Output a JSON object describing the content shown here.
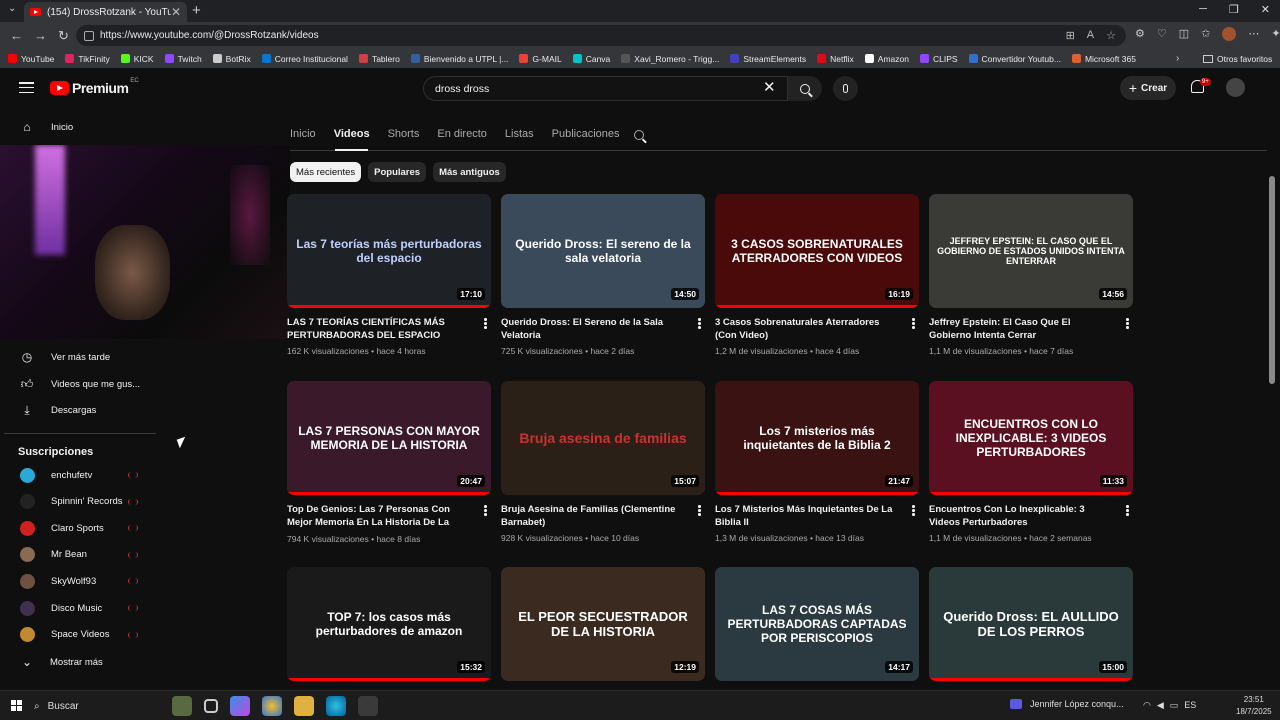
{
  "browser": {
    "tab_title": "(154) DrossRotzank - YouTube",
    "tab_close": "✕",
    "new_tab": "+",
    "url": "https://www.youtube.com/@DrossRotzank/videos",
    "bookmarks": [
      {
        "label": "YouTube",
        "color": "#ff0000"
      },
      {
        "label": "TikFinity",
        "color": "#e0245e"
      },
      {
        "label": "KICK",
        "color": "#53fc18"
      },
      {
        "label": "Twitch",
        "color": "#9146ff"
      },
      {
        "label": "BotRix",
        "color": "#cccccc"
      },
      {
        "label": "Correo Institucional",
        "color": "#0078d4"
      },
      {
        "label": "Tablero",
        "color": "#d04040"
      },
      {
        "label": "Bienvenido a UTPL |...",
        "color": "#3060a0"
      },
      {
        "label": "G-MAIL",
        "color": "#ea4335"
      },
      {
        "label": "Canva",
        "color": "#00c4cc"
      },
      {
        "label": "Xavi_Romero - Trigg...",
        "color": "#555555"
      },
      {
        "label": "StreamElements",
        "color": "#4040c0"
      },
      {
        "label": "Netflix",
        "color": "#e50914"
      },
      {
        "label": "Amazon",
        "color": "#ffffff"
      },
      {
        "label": "CLIPS",
        "color": "#9146ff"
      },
      {
        "label": "Convertidor Youtub...",
        "color": "#3070d0"
      },
      {
        "label": "Microsoft 365",
        "color": "#e06030"
      }
    ],
    "bookmarks_more": "›",
    "other_favorites": "Otros favoritos"
  },
  "header": {
    "logo_text": "Premium",
    "country": "EC",
    "search_value": "dross dross",
    "create_label": "Crear",
    "notif_count": "9+"
  },
  "sidebar": {
    "home": "Inicio",
    "watch_later": "Ver más tarde",
    "liked": "Videos que me gus...",
    "downloads": "Descargas",
    "subs_title": "Suscripciones",
    "subscriptions": [
      {
        "name": "enchufetv",
        "color": "#2aa8d8"
      },
      {
        "name": "Spinnin' Records",
        "color": "#222222"
      },
      {
        "name": "Claro Sports",
        "color": "#d02020"
      },
      {
        "name": "Mr Bean",
        "color": "#8a6a50"
      },
      {
        "name": "SkyWolf93",
        "color": "#705040"
      },
      {
        "name": "Disco Music",
        "color": "#403050"
      },
      {
        "name": "Space Videos",
        "color": "#c08a30"
      }
    ],
    "show_more": "Mostrar más"
  },
  "channel": {
    "tabs": [
      "Inicio",
      "Videos",
      "Shorts",
      "En directo",
      "Listas",
      "Publicaciones"
    ],
    "chips": [
      "Más recientes",
      "Populares",
      "Más antiguos"
    ]
  },
  "videos": [
    {
      "thumb_text": "Las 7 teorías más perturbadoras del espacio",
      "thumb_bg": "#1e2226",
      "thumb_color": "#c0d0ff",
      "duration": "17:10",
      "title": "LAS 7 TEORÍAS CIENTÍFICAS MÁS PERTURBADORAS DEL ESPACIO",
      "meta": "162 K visualizaciones • hace 4 horas",
      "progress": 1.0
    },
    {
      "thumb_text": "Querido Dross: El sereno de la sala velatoria",
      "thumb_bg": "#3a4a5a",
      "thumb_color": "#ffffff",
      "duration": "14:50",
      "title": "Querido Dross: El Sereno de la Sala Velatoria",
      "meta": "725 K visualizaciones • hace 2 días",
      "progress": 0
    },
    {
      "thumb_text": "3 CASOS SOBRENATURALES ATERRADORES CON VIDEOS",
      "thumb_bg": "#4a0a0a",
      "thumb_color": "#ffffff",
      "duration": "16:19",
      "title": "3 Casos Sobrenaturales Aterradores (Con Video)",
      "meta": "1,2 M de visualizaciones • hace 4 días",
      "progress": 1.0
    },
    {
      "thumb_text": "JEFFREY EPSTEIN: EL CASO QUE EL GOBIERNO DE ESTADOS UNIDOS INTENTA ENTERRAR",
      "thumb_bg": "#3a3a36",
      "thumb_color": "#ffffff",
      "duration": "14:56",
      "title": "Jeffrey Epstein: El Caso Que El Gobierno Intenta Cerrar",
      "meta": "1,1 M de visualizaciones • hace 7 días",
      "progress": 0
    },
    {
      "thumb_text": "LAS 7 PERSONAS CON MAYOR MEMORIA DE LA HISTORIA",
      "thumb_bg": "#3a1a2a",
      "thumb_color": "#ffffff",
      "duration": "20:47",
      "title": "Top De Genios: Las 7 Personas Con Mejor Memoria En La Historia De La Humanidad...",
      "meta": "794 K visualizaciones • hace 8 días",
      "progress": 1.0
    },
    {
      "thumb_text": "Bruja asesina de familias",
      "thumb_bg": "#2a2018",
      "thumb_color": "#d03030",
      "duration": "15:07",
      "title": "Bruja Asesina de Familias (Clementine Barnabet)",
      "meta": "928 K visualizaciones • hace 10 días",
      "progress": 0
    },
    {
      "thumb_text": "Los 7 misterios más inquietantes de la Biblia 2",
      "thumb_bg": "#3a1212",
      "thumb_color": "#ffffff",
      "duration": "21:47",
      "title": "Los 7 Misterios Más Inquietantes De La Biblia II",
      "meta": "1,3 M de visualizaciones • hace 13 días",
      "progress": 1.0
    },
    {
      "thumb_text": "ENCUENTROS CON LO INEXPLICABLE: 3 VIDEOS PERTURBADORES",
      "thumb_bg": "#5a1020",
      "thumb_color": "#ffffff",
      "duration": "11:33",
      "title": "Encuentros Con Lo Inexplicable: 3 Videos Perturbadores",
      "meta": "1,1 M de visualizaciones • hace 2 semanas",
      "progress": 1.0
    },
    {
      "thumb_text": "TOP 7: los casos más perturbadores de amazon",
      "thumb_bg": "#1a1a1a",
      "thumb_color": "#ffffff",
      "duration": "15:32",
      "progress": 1.0
    },
    {
      "thumb_text": "EL PEOR SECUESTRADOR DE LA HISTORIA",
      "thumb_bg": "#3a2a20",
      "thumb_color": "#ffffff",
      "duration": "12:19",
      "progress": 0
    },
    {
      "thumb_text": "LAS 7 COSAS MÁS PERTURBADORAS CAPTADAS POR PERISCOPIOS",
      "thumb_bg": "#2a3a40",
      "thumb_color": "#ffffff",
      "duration": "14:17",
      "progress": 0
    },
    {
      "thumb_text": "Querido Dross: EL AULLIDO DE LOS PERROS",
      "thumb_bg": "#2a3a3a",
      "thumb_color": "#ffffff",
      "duration": "15:00",
      "progress": 1.0
    }
  ],
  "taskbar": {
    "search": "Buscar",
    "media": "Jennifer López conqu...",
    "time": "23:51",
    "date": "18/7/2025"
  },
  "icons": {
    "home": "home-icon",
    "watch_later": "clock-icon",
    "liked": "thumbs-up-icon",
    "downloads": "download-icon"
  },
  "colors": {
    "background": "#0f0f0f",
    "accent_red": "#ff0000"
  }
}
